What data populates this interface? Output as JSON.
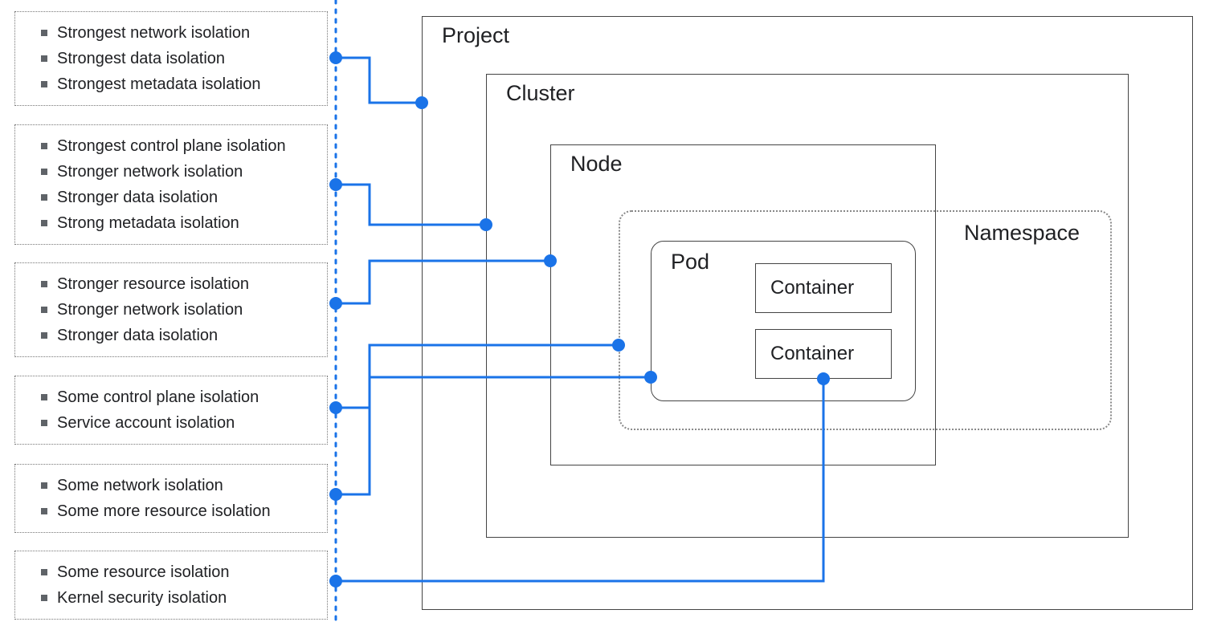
{
  "left_panels": [
    {
      "id": "project",
      "items": [
        "Strongest network isolation",
        "Strongest data isolation",
        "Strongest metadata isolation"
      ]
    },
    {
      "id": "cluster",
      "items": [
        "Strongest control plane isolation",
        "Stronger network isolation",
        "Stronger data isolation",
        "Strong metadata isolation"
      ]
    },
    {
      "id": "node",
      "items": [
        "Stronger resource isolation",
        "Stronger network isolation",
        "Stronger data isolation"
      ]
    },
    {
      "id": "namespace",
      "items": [
        "Some control plane isolation",
        "Service account isolation"
      ]
    },
    {
      "id": "pod",
      "items": [
        "Some network isolation",
        "Some more resource isolation"
      ]
    },
    {
      "id": "container",
      "items": [
        "Some resource isolation",
        "Kernel security isolation"
      ]
    }
  ],
  "hierarchy": {
    "project": "Project",
    "cluster": "Cluster",
    "node": "Node",
    "namespace": "Namespace",
    "pod": "Pod",
    "container1": "Container",
    "container2": "Container"
  },
  "colors": {
    "connector": "#1a73e8",
    "dot": "#1a73e8",
    "vertical_dotted": "#1a73e8"
  }
}
